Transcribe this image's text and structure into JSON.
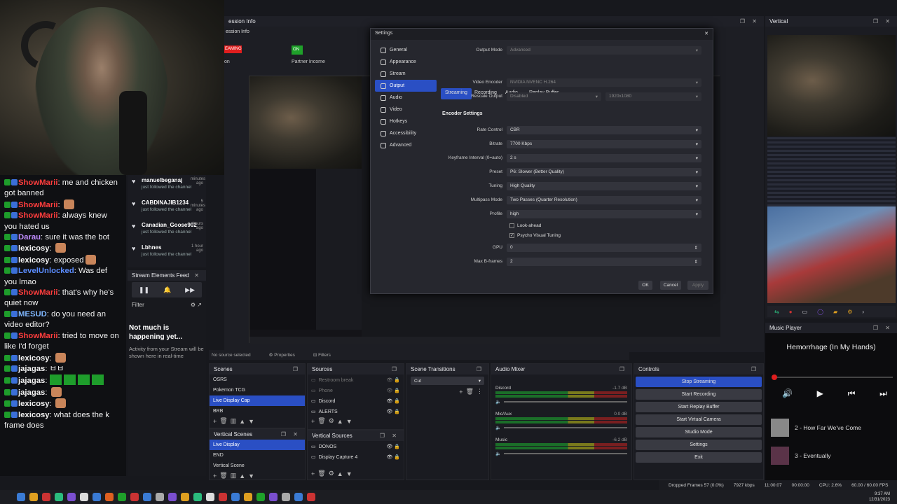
{
  "chat": {
    "messages": [
      {
        "user": "ShowMarii",
        "color": "#ff3d3d",
        "text": "me and chicken got banned"
      },
      {
        "user": "ShowMarii",
        "color": "#ff3d3d",
        "text": ""
      },
      {
        "user": "ShowMarii",
        "color": "#ff3d3d",
        "text": "always knew you hated us"
      },
      {
        "user": "Darau",
        "color": "#c08cff",
        "text": "sure it was the bot"
      },
      {
        "user": "lexicosy",
        "color": "#f2f2f2",
        "text": ""
      },
      {
        "user": "lexicosy",
        "color": "#f2f2f2",
        "text": "exposed"
      },
      {
        "user": "LevelUnlocked",
        "color": "#5b8cff",
        "text": "Was def you lmao"
      },
      {
        "user": "ShowMarii",
        "color": "#ff3d3d",
        "text": "that's why he's quiet now"
      },
      {
        "user": "MESUD",
        "color": "#7fb7ff",
        "text": "do you need an video editor?"
      },
      {
        "user": "ShowMarii",
        "color": "#ff3d3d",
        "text": "tried to move on like I'd forget"
      },
      {
        "user": "lexicosy",
        "color": "#f2f2f2",
        "text": ""
      },
      {
        "user": "jajagas",
        "color": "#f2f2f2",
        "text": "ㅂㅂ"
      },
      {
        "user": "jajagas",
        "color": "#f2f2f2",
        "text": ""
      },
      {
        "user": "jajagas",
        "color": "#f2f2f2",
        "text": ""
      },
      {
        "user": "lexicosy",
        "color": "#f2f2f2",
        "text": ""
      },
      {
        "user": "lexicosy",
        "color": "#f2f2f2",
        "text": "what does the k frame does"
      }
    ]
  },
  "follows": [
    {
      "name": "manuelbeganaj",
      "sub": "just followed the channel",
      "ago": "minutes ago"
    },
    {
      "name": "CABDINAJIB1234",
      "sub": "just followed the channel",
      "ago": "5 minutes ago"
    },
    {
      "name": "Canadian_Goose902",
      "sub": "just followed the channel",
      "ago": "hours ago"
    },
    {
      "name": "Lbhnes",
      "sub": "just followed the channel",
      "ago": "1 hour ago"
    }
  ],
  "stream_elements": {
    "title": "Stream Elements Feed",
    "filter": "Filter",
    "empty_title": "Not much is happening yet...",
    "empty_sub": "Activity from your Stream will be shown here in real-time"
  },
  "session": {
    "title": "ession Info",
    "subtitle": "ession Info",
    "streaming_badge": "EAMING",
    "on_badge": "ON",
    "partner": "Partner Income",
    "left_label": "on"
  },
  "settings": {
    "title": "Settings",
    "nav": [
      "General",
      "Appearance",
      "Stream",
      "Output",
      "Audio",
      "Video",
      "Hotkeys",
      "Accessibility",
      "Advanced"
    ],
    "output_mode_label": "Output Mode",
    "output_mode": "Advanced",
    "tabs": [
      "Streaming",
      "Recording",
      "Audio",
      "Replay Buffer"
    ],
    "video_encoder_label": "Video Encoder",
    "video_encoder": "NVIDIA NVENC H.264",
    "rescale_label": "Rescale Output",
    "rescale": "Disabled",
    "rescale_res": "1920x1080",
    "encoder_settings": "Encoder Settings",
    "fields": [
      {
        "label": "Rate Control",
        "value": "CBR"
      },
      {
        "label": "Bitrate",
        "value": "7700 Kbps"
      },
      {
        "label": "Keyframe Interval (0=auto)",
        "value": "2 s"
      },
      {
        "label": "Preset",
        "value": "P6: Slower (Better Quality)"
      },
      {
        "label": "Tuning",
        "value": "High Quality"
      },
      {
        "label": "Multipass Mode",
        "value": "Two Passes (Quarter Resolution)"
      },
      {
        "label": "Profile",
        "value": "high"
      }
    ],
    "lookahead": "Look-ahead",
    "psycho": "Psycho Visual Tuning",
    "gpu_label": "GPU",
    "gpu": "0",
    "bframes_label": "Max B-frames",
    "bframes": "2",
    "ok": "OK",
    "cancel": "Cancel",
    "apply": "Apply"
  },
  "source_bar": {
    "none": "No source selected",
    "properties": "Properties",
    "filters": "Filters"
  },
  "scenes": {
    "title": "Scenes",
    "items": [
      "OSRS",
      "Pokemon TCG",
      "Live Display Cap",
      "BRB"
    ],
    "selected": 2
  },
  "vertical_scenes": {
    "title": "Vertical Scenes",
    "items": [
      "Live Display",
      "END",
      "Vertical Scene"
    ],
    "selected": 0
  },
  "sources": {
    "title": "Sources",
    "items": [
      "Restroom break",
      "Phone",
      "Discord",
      "ALERTS"
    ]
  },
  "vertical_sources": {
    "title": "Vertical Sources",
    "items": [
      "DONOS",
      "Display Capture 4"
    ]
  },
  "transitions": {
    "title": "Scene Transitions",
    "value": "Cut"
  },
  "mixer": {
    "title": "Audio Mixer",
    "channels": [
      {
        "name": "Discord",
        "db": "-1.7 dB"
      },
      {
        "name": "Mic/Aux",
        "db": "0.0 dB"
      },
      {
        "name": "Music",
        "db": "-6.2 dB"
      }
    ]
  },
  "controls": {
    "title": "Controls",
    "buttons": [
      "Stop Streaming",
      "Start Recording",
      "Start Replay Buffer",
      "Start Virtual Camera",
      "Studio Mode",
      "Settings",
      "Exit"
    ]
  },
  "status": {
    "dropped": "Dropped Frames 57 (0.0%)",
    "kbps": "7927 kbps",
    "time": "11:00:07",
    "rec": "00:00:00",
    "cpu": "CPU: 2.6%",
    "fps": "60.00 / 60.00 FPS"
  },
  "vertical_panel": {
    "title": "Vertical"
  },
  "music": {
    "title": "Music Player",
    "now_playing": "Hemorrhage (In My Hands)",
    "queue": [
      {
        "title": "2 - How Far We've Come"
      },
      {
        "title": "3 - Eventually"
      }
    ]
  },
  "clock": {
    "time": "9:37 AM",
    "date": "12/31/2023"
  },
  "colors": {
    "accent": "#2a4fc4",
    "live": "#e01e1e"
  }
}
